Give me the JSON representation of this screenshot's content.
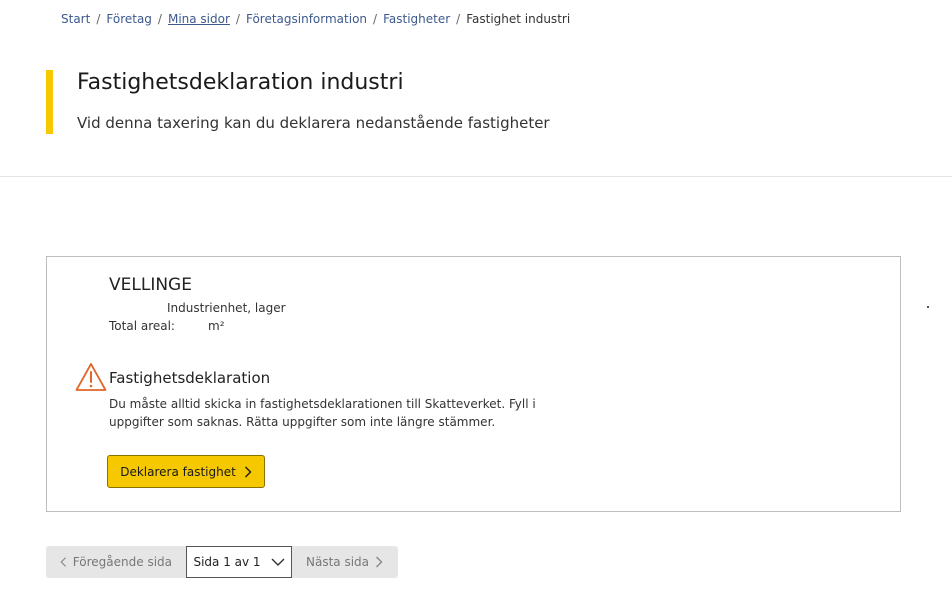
{
  "breadcrumb": {
    "items": [
      {
        "label": "Start"
      },
      {
        "label": "Företag"
      },
      {
        "label": "Mina sidor"
      },
      {
        "label": "Företagsinformation"
      },
      {
        "label": "Fastigheter"
      },
      {
        "label": "Fastighet industri"
      }
    ],
    "separator": "/"
  },
  "header": {
    "title": "Fastighetsdeklaration industri",
    "subtitle": "Vid denna taxering kan du deklarera nedanstående fastigheter",
    "accent_color": "#f6c800"
  },
  "property_card": {
    "municipality": "VELLINGE",
    "property_type": "Industrienhet, lager",
    "area_label": "Total areal:",
    "area_unit": "m²",
    "declaration": {
      "icon": "warning-icon",
      "warning_color": "#e0662a",
      "title": "Fastighetsdeklaration",
      "text": "Du måste alltid skicka in fastighetsdeklarationen till Skatteverket. Fyll i uppgifter som saknas. Rätta uppgifter som inte längre stämmer.",
      "button_label": "Deklarera fastighet",
      "button_color": "#f6c800"
    }
  },
  "pagination": {
    "prev_label": "Föregående sida",
    "current_page": "Sida 1 av 1",
    "next_label": "Nästa sida"
  }
}
